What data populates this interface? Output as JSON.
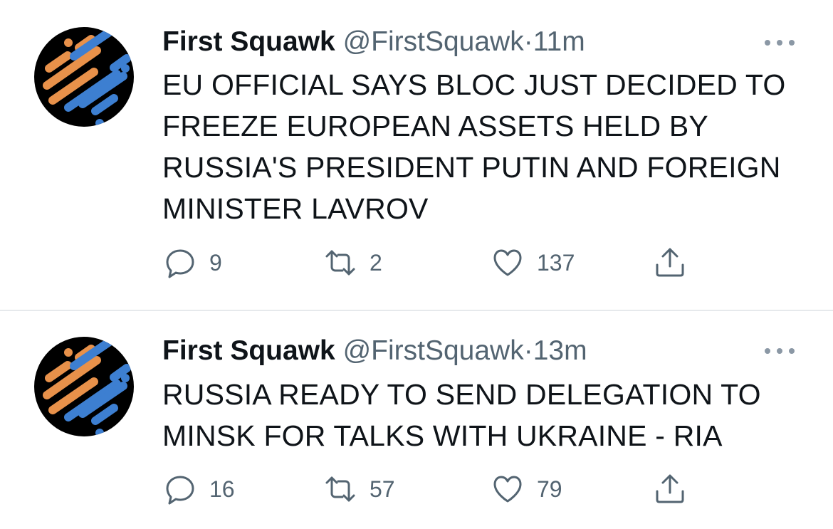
{
  "tweets": [
    {
      "display_name": "First Squawk",
      "handle": "@FirstSquawk",
      "separator": "·",
      "time": "11m",
      "text": "EU OFFICIAL SAYS BLOC JUST DECIDED TO FREEZE EUROPEAN ASSETS HELD BY RUSSIA'S PRESIDENT PUTIN AND FOREIGN MINISTER LAVROV",
      "replies": "9",
      "retweets": "2",
      "likes": "137"
    },
    {
      "display_name": "First Squawk",
      "handle": "@FirstSquawk",
      "separator": "·",
      "time": "13m",
      "text": "RUSSIA READY TO SEND DELEGATION TO MINSK FOR TALKS WITH UKRAINE - RIA",
      "replies": "16",
      "retweets": "57",
      "likes": "79"
    }
  ],
  "icons": {
    "more": "more-horizontal-icon",
    "reply": "speech-bubble-icon",
    "retweet": "retweet-arrows-icon",
    "like": "heart-icon",
    "share": "share-upload-icon"
  },
  "colors": {
    "avatar_orange": "#E8914A",
    "avatar_blue": "#3D7FD1",
    "avatar_bg": "#000000",
    "secondary_text": "#536471",
    "divider": "#E6E9EC"
  }
}
